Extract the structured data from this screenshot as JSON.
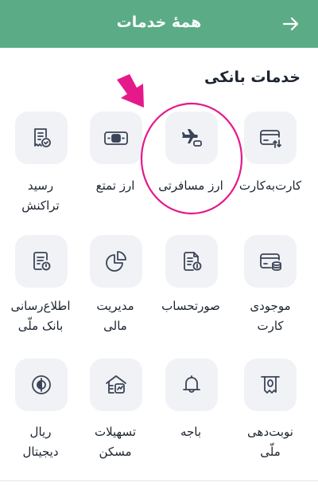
{
  "header": {
    "title": "همهٔ خدمات"
  },
  "section": {
    "title": "خدمات بانکی"
  },
  "services": [
    {
      "lines": [
        "کارت‌به‌کارت"
      ],
      "icon": "card-transfer-icon"
    },
    {
      "lines": [
        "ارز مسافرتی"
      ],
      "icon": "airplane-icon"
    },
    {
      "lines": [
        "ارز تمتع"
      ],
      "icon": "cash-note-icon"
    },
    {
      "lines": [
        "رسید",
        "تراکنش"
      ],
      "icon": "receipt-icon"
    },
    {
      "lines": [
        "موجودی",
        "کارت"
      ],
      "icon": "card-balance-icon"
    },
    {
      "lines": [
        "صورتحساب"
      ],
      "icon": "statement-icon"
    },
    {
      "lines": [
        "مدیریت",
        "مالی"
      ],
      "icon": "pie-chart-icon"
    },
    {
      "lines": [
        "اطلاع‌رسانی",
        "بانک ملّی"
      ],
      "icon": "notification-document-icon"
    },
    {
      "lines": [
        "نوبت‌دهی",
        "ملّی"
      ],
      "icon": "queue-ticket-icon"
    },
    {
      "lines": [
        "باجه"
      ],
      "icon": "bell-counter-icon"
    },
    {
      "lines": [
        "تسهیلات",
        "مسکن"
      ],
      "icon": "house-loan-icon"
    },
    {
      "lines": [
        "ریال",
        "دیجیتال"
      ],
      "icon": "digital-rial-icon"
    }
  ],
  "colors": {
    "header": "#5aab86",
    "annotation": "#e6198a",
    "tile": "#f1f2f5",
    "icon": "#3b4558"
  }
}
